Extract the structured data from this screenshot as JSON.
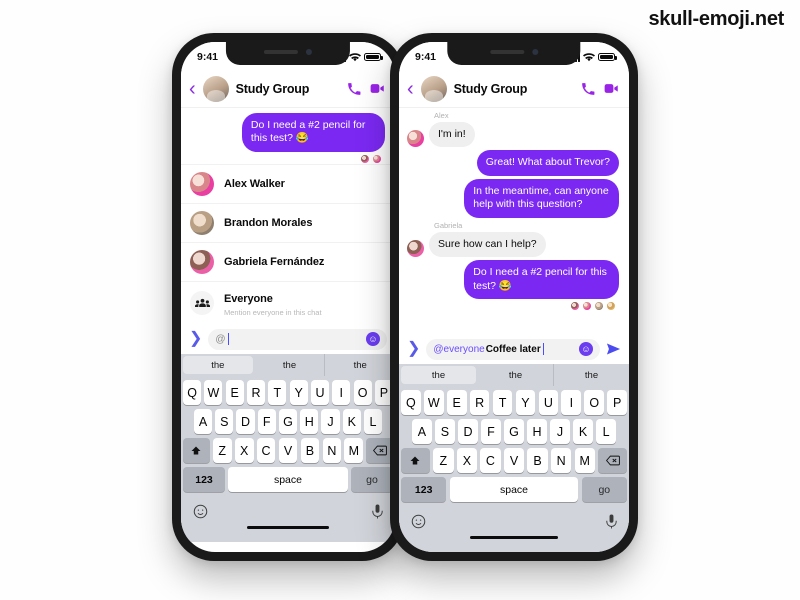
{
  "watermark": "skull-emoji.net",
  "phones": {
    "left": {
      "status": {
        "time": "9:41",
        "signal_icon": "signal-bars-icon",
        "wifi_icon": "wifi-icon",
        "battery_icon": "battery-icon"
      },
      "header": {
        "back_icon": "chevron-left-icon",
        "avatar": "group-avatar",
        "title": "Study Group",
        "call_icon": "phone-icon",
        "video_icon": "video-camera-icon"
      },
      "messages": [
        {
          "side": "out",
          "text": "Do I need a #2 pencil for this test? 😂"
        }
      ],
      "reactions": [
        "reaction-avatar-1",
        "reaction-avatar-2"
      ],
      "mention_list": [
        {
          "name": "Alex Walker",
          "sub": "",
          "avatar": "av-pink",
          "icon": ""
        },
        {
          "name": "Brandon Morales",
          "sub": "",
          "avatar": "av-tan",
          "icon": ""
        },
        {
          "name": "Gabriela Fernández",
          "sub": "",
          "avatar": "av-rose",
          "icon": ""
        },
        {
          "name": "Everyone",
          "sub": "Mention everyone in this chat",
          "avatar": "",
          "icon": "people-group-icon"
        }
      ],
      "composer": {
        "expand_icon": "chevron-right-icon",
        "mention": "@",
        "text": "",
        "emoji_icon": "emoji-smiley-icon"
      },
      "keyboard": {
        "suggestions": [
          "the",
          "the",
          "the"
        ],
        "row1": [
          "Q",
          "W",
          "E",
          "R",
          "T",
          "Y",
          "U",
          "I",
          "O",
          "P"
        ],
        "row2": [
          "A",
          "S",
          "D",
          "F",
          "G",
          "H",
          "J",
          "K",
          "L"
        ],
        "row3": [
          "Z",
          "X",
          "C",
          "V",
          "B",
          "N",
          "M"
        ],
        "shift_icon": "shift-arrow-icon",
        "backspace_icon": "backspace-icon",
        "num_label": "123",
        "space_label": "space",
        "go_label": "go",
        "emoji_icon": "emoji-smiley-icon",
        "mic_icon": "microphone-icon"
      }
    },
    "right": {
      "status": {
        "time": "9:41",
        "signal_icon": "signal-bars-icon",
        "wifi_icon": "wifi-icon",
        "battery_icon": "battery-icon"
      },
      "header": {
        "back_icon": "chevron-left-icon",
        "avatar": "group-avatar",
        "title": "Study Group",
        "call_icon": "phone-icon",
        "video_icon": "video-camera-icon"
      },
      "messages": [
        {
          "side": "in",
          "sender": "Alex",
          "text": "I'm in!",
          "avatar": "av-pink"
        },
        {
          "side": "out",
          "sender": "",
          "text": "Great! What about Trevor?",
          "avatar": ""
        },
        {
          "side": "out",
          "sender": "",
          "text": "In the meantime, can anyone help with this question?",
          "avatar": ""
        },
        {
          "side": "in",
          "sender": "Gabriela",
          "text": "Sure how can I help?",
          "avatar": "av-rose"
        },
        {
          "side": "out",
          "sender": "",
          "text": "Do I need a #2 pencil for this test? 😂",
          "avatar": ""
        }
      ],
      "reactions": [
        "reaction-avatar-1",
        "reaction-avatar-2",
        "reaction-avatar-3",
        "reaction-avatar-4"
      ],
      "composer": {
        "expand_icon": "chevron-right-icon",
        "mention": "@everyone",
        "text": " Coffee later",
        "emoji_icon": "emoji-smiley-icon",
        "send_icon": "send-paper-plane-icon"
      },
      "keyboard": {
        "suggestions": [
          "the",
          "the",
          "the"
        ],
        "row1": [
          "Q",
          "W",
          "E",
          "R",
          "T",
          "Y",
          "U",
          "I",
          "O",
          "P"
        ],
        "row2": [
          "A",
          "S",
          "D",
          "F",
          "G",
          "H",
          "J",
          "K",
          "L"
        ],
        "row3": [
          "Z",
          "X",
          "C",
          "V",
          "B",
          "N",
          "M"
        ],
        "shift_icon": "shift-arrow-icon",
        "backspace_icon": "backspace-icon",
        "num_label": "123",
        "space_label": "space",
        "go_label": "go",
        "emoji_icon": "emoji-smiley-icon",
        "mic_icon": "microphone-icon"
      }
    }
  },
  "colors": {
    "brand_purple": "#7b29f2",
    "header_accent": "#9a23e8",
    "incoming_bubble": "#efefef",
    "keyboard_bg": "#d1d4da"
  }
}
